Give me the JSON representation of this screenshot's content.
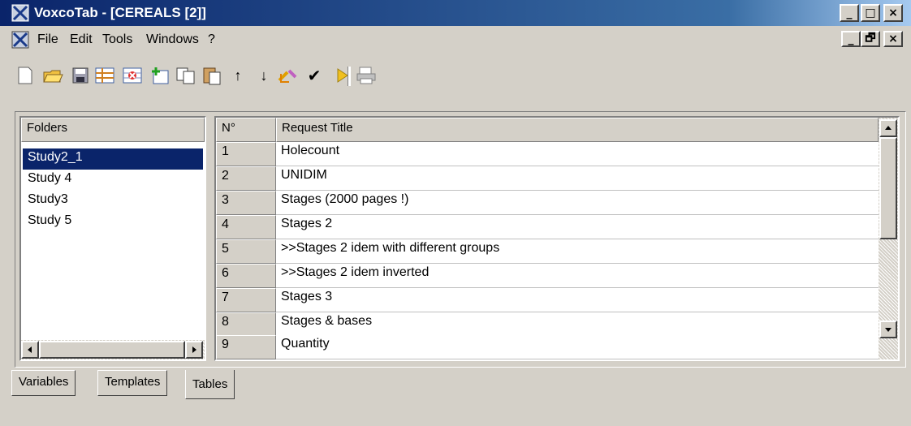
{
  "window": {
    "title": "VoxcoTab - [CEREALS [2]]",
    "controls": [
      "_",
      "□",
      "×"
    ],
    "doc_controls": [
      "_",
      "🗗",
      "×"
    ]
  },
  "menu": [
    "File",
    "Edit",
    "Tools",
    "Windows",
    "?"
  ],
  "toolbar": {
    "icons": [
      "new-doc-icon",
      "open-folder-icon",
      "save-icon",
      "table-icon",
      "delete-icon",
      "add-icon",
      "copy-icon",
      "paste-icon",
      "up-arrow-icon",
      "down-arrow-icon",
      "import-icon",
      "check-icon",
      "run-icon",
      "print-icon"
    ],
    "up_glyph": "↑",
    "down_glyph": "↓",
    "check_glyph": "✔"
  },
  "folders": {
    "header": "Folders",
    "items": [
      "Study2_1",
      "Study 4",
      "Study3",
      "Study 5"
    ],
    "selected": "Study2_1"
  },
  "requests": {
    "columns": [
      "N°",
      "Request Title"
    ],
    "rows": [
      {
        "n": "1",
        "title": "Holecount"
      },
      {
        "n": "2",
        "title": "UNIDIM"
      },
      {
        "n": "3",
        "title": "Stages  (2000 pages !)"
      },
      {
        "n": "4",
        "title": "Stages 2"
      },
      {
        "n": "5",
        "title": ">>Stages 2 idem with different groups"
      },
      {
        "n": "6",
        "title": ">>Stages 2 idem inverted"
      },
      {
        "n": "7",
        "title": "Stages 3"
      },
      {
        "n": "8",
        "title": "Stages & bases"
      },
      {
        "n": "9",
        "title": "Quantity"
      }
    ]
  },
  "tabs": [
    "Variables",
    "Templates",
    "Tables"
  ],
  "active_tab": "Tables",
  "colors": {
    "selection": "#0a246a",
    "titlebar": "#0a246a",
    "face": "#d4d0c8"
  }
}
